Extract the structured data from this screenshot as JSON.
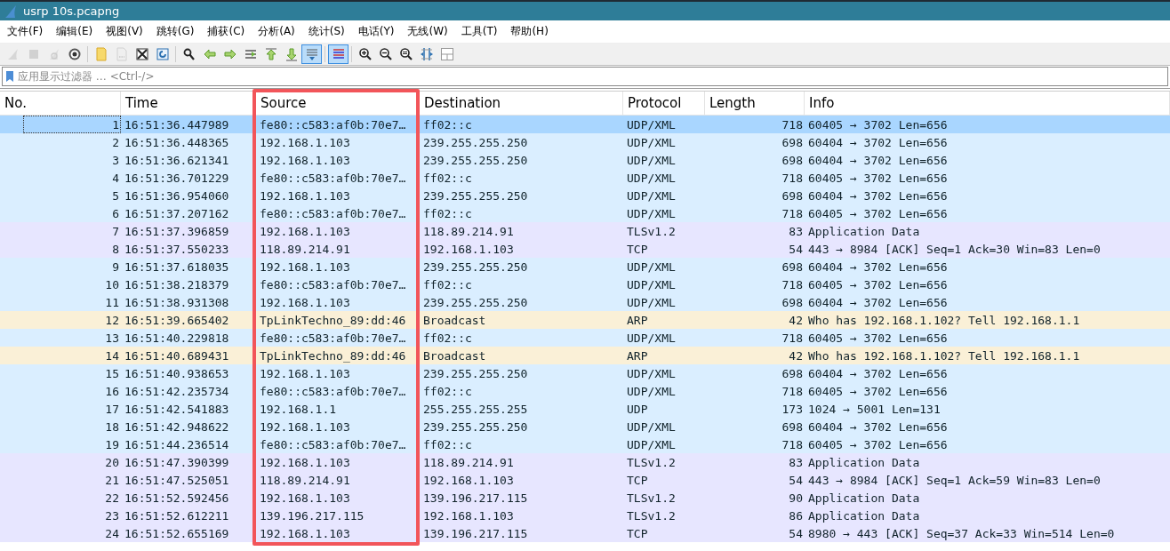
{
  "window": {
    "title": "usrp 10s.pcapng"
  },
  "menu": [
    "文件(F)",
    "编辑(E)",
    "视图(V)",
    "跳转(G)",
    "捕获(C)",
    "分析(A)",
    "统计(S)",
    "电话(Y)",
    "无线(W)",
    "工具(T)",
    "帮助(H)"
  ],
  "toolbar": [
    [
      {
        "kind": "start",
        "disabled": true,
        "pressed": false
      },
      {
        "kind": "stop",
        "disabled": true,
        "pressed": false
      },
      {
        "kind": "restart",
        "disabled": true,
        "pressed": false
      },
      {
        "kind": "options",
        "disabled": false,
        "pressed": false
      }
    ],
    [
      {
        "kind": "open",
        "disabled": false,
        "pressed": false
      },
      {
        "kind": "save",
        "disabled": true,
        "pressed": false
      },
      {
        "kind": "close",
        "disabled": false,
        "pressed": false
      },
      {
        "kind": "reload",
        "disabled": false,
        "pressed": false
      }
    ],
    [
      {
        "kind": "find",
        "disabled": false,
        "pressed": false
      },
      {
        "kind": "back",
        "disabled": false,
        "pressed": false
      },
      {
        "kind": "forward",
        "disabled": false,
        "pressed": false
      },
      {
        "kind": "goto",
        "disabled": false,
        "pressed": false
      },
      {
        "kind": "first",
        "disabled": false,
        "pressed": false
      },
      {
        "kind": "last",
        "disabled": false,
        "pressed": false
      },
      {
        "kind": "autoscroll",
        "disabled": false,
        "pressed": true
      }
    ],
    [
      {
        "kind": "colorize",
        "disabled": false,
        "pressed": true
      }
    ],
    [
      {
        "kind": "zoom-in",
        "disabled": false,
        "pressed": false
      },
      {
        "kind": "zoom-out",
        "disabled": false,
        "pressed": false
      },
      {
        "kind": "zoom-reset",
        "disabled": false,
        "pressed": false
      },
      {
        "kind": "resize",
        "disabled": false,
        "pressed": false
      },
      {
        "kind": "layout",
        "disabled": false,
        "pressed": false
      }
    ]
  ],
  "filter": {
    "placeholder": "应用显示过滤器 … <Ctrl-/>"
  },
  "table": {
    "columns": [
      {
        "label": "No.",
        "highlighted": false
      },
      {
        "label": "Time",
        "highlighted": false
      },
      {
        "label": "Source",
        "highlighted": true
      },
      {
        "label": "Destination",
        "highlighted": false
      },
      {
        "label": "Protocol",
        "highlighted": false
      },
      {
        "label": "Length",
        "highlighted": false
      },
      {
        "label": "Info",
        "highlighted": false
      }
    ],
    "rows": [
      {
        "cells": [
          "1",
          "16:51:36.447989",
          "fe80::c583:af0b:70e7…",
          "ff02::c",
          "UDP/XML",
          "718",
          "60405 → 3702 Len=656"
        ],
        "selected": true
      },
      {
        "cells": [
          "2",
          "16:51:36.448365",
          "192.168.1.103",
          "239.255.255.250",
          "UDP/XML",
          "698",
          "60404 → 3702 Len=656"
        ],
        "selected": false,
        "color": "#daeeff"
      },
      {
        "cells": [
          "3",
          "16:51:36.621341",
          "192.168.1.103",
          "239.255.255.250",
          "UDP/XML",
          "698",
          "60404 → 3702 Len=656"
        ],
        "selected": false,
        "color": "#daeeff"
      },
      {
        "cells": [
          "4",
          "16:51:36.701229",
          "fe80::c583:af0b:70e7…",
          "ff02::c",
          "UDP/XML",
          "718",
          "60405 → 3702 Len=656"
        ],
        "selected": false,
        "color": "#daeeff"
      },
      {
        "cells": [
          "5",
          "16:51:36.954060",
          "192.168.1.103",
          "239.255.255.250",
          "UDP/XML",
          "698",
          "60404 → 3702 Len=656"
        ],
        "selected": false,
        "color": "#daeeff"
      },
      {
        "cells": [
          "6",
          "16:51:37.207162",
          "fe80::c583:af0b:70e7…",
          "ff02::c",
          "UDP/XML",
          "718",
          "60405 → 3702 Len=656"
        ],
        "selected": false,
        "color": "#daeeff"
      },
      {
        "cells": [
          "7",
          "16:51:37.396859",
          "192.168.1.103",
          "118.89.214.91",
          "TLSv1.2",
          "83",
          "Application Data"
        ],
        "selected": false,
        "color": "#e7e6ff"
      },
      {
        "cells": [
          "8",
          "16:51:37.550233",
          "118.89.214.91",
          "192.168.1.103",
          "TCP",
          "54",
          "443 → 8984 [ACK] Seq=1 Ack=30 Win=83 Len=0"
        ],
        "selected": false,
        "color": "#e7e6ff"
      },
      {
        "cells": [
          "9",
          "16:51:37.618035",
          "192.168.1.103",
          "239.255.255.250",
          "UDP/XML",
          "698",
          "60404 → 3702 Len=656"
        ],
        "selected": false,
        "color": "#daeeff"
      },
      {
        "cells": [
          "10",
          "16:51:38.218379",
          "fe80::c583:af0b:70e7…",
          "ff02::c",
          "UDP/XML",
          "718",
          "60405 → 3702 Len=656"
        ],
        "selected": false,
        "color": "#daeeff"
      },
      {
        "cells": [
          "11",
          "16:51:38.931308",
          "192.168.1.103",
          "239.255.255.250",
          "UDP/XML",
          "698",
          "60404 → 3702 Len=656"
        ],
        "selected": false,
        "color": "#daeeff"
      },
      {
        "cells": [
          "12",
          "16:51:39.665402",
          "TpLinkTechno_89:dd:46",
          "Broadcast",
          "ARP",
          "42",
          "Who has 192.168.1.102? Tell 192.168.1.1"
        ],
        "selected": false,
        "color": "#faf0d7"
      },
      {
        "cells": [
          "13",
          "16:51:40.229818",
          "fe80::c583:af0b:70e7…",
          "ff02::c",
          "UDP/XML",
          "718",
          "60405 → 3702 Len=656"
        ],
        "selected": false,
        "color": "#daeeff"
      },
      {
        "cells": [
          "14",
          "16:51:40.689431",
          "TpLinkTechno_89:dd:46",
          "Broadcast",
          "ARP",
          "42",
          "Who has 192.168.1.102? Tell 192.168.1.1"
        ],
        "selected": false,
        "color": "#faf0d7"
      },
      {
        "cells": [
          "15",
          "16:51:40.938653",
          "192.168.1.103",
          "239.255.255.250",
          "UDP/XML",
          "698",
          "60404 → 3702 Len=656"
        ],
        "selected": false,
        "color": "#daeeff"
      },
      {
        "cells": [
          "16",
          "16:51:42.235734",
          "fe80::c583:af0b:70e7…",
          "ff02::c",
          "UDP/XML",
          "718",
          "60405 → 3702 Len=656"
        ],
        "selected": false,
        "color": "#daeeff"
      },
      {
        "cells": [
          "17",
          "16:51:42.541883",
          "192.168.1.1",
          "255.255.255.255",
          "UDP",
          "173",
          "1024 → 5001 Len=131"
        ],
        "selected": false,
        "color": "#daeeff"
      },
      {
        "cells": [
          "18",
          "16:51:42.948622",
          "192.168.1.103",
          "239.255.255.250",
          "UDP/XML",
          "698",
          "60404 → 3702 Len=656"
        ],
        "selected": false,
        "color": "#daeeff"
      },
      {
        "cells": [
          "19",
          "16:51:44.236514",
          "fe80::c583:af0b:70e7…",
          "ff02::c",
          "UDP/XML",
          "718",
          "60405 → 3702 Len=656"
        ],
        "selected": false,
        "color": "#daeeff"
      },
      {
        "cells": [
          "20",
          "16:51:47.390399",
          "192.168.1.103",
          "118.89.214.91",
          "TLSv1.2",
          "83",
          "Application Data"
        ],
        "selected": false,
        "color": "#e7e6ff"
      },
      {
        "cells": [
          "21",
          "16:51:47.525051",
          "118.89.214.91",
          "192.168.1.103",
          "TCP",
          "54",
          "443 → 8984 [ACK] Seq=1 Ack=59 Win=83 Len=0"
        ],
        "selected": false,
        "color": "#e7e6ff"
      },
      {
        "cells": [
          "22",
          "16:51:52.592456",
          "192.168.1.103",
          "139.196.217.115",
          "TLSv1.2",
          "90",
          "Application Data"
        ],
        "selected": false,
        "color": "#e7e6ff"
      },
      {
        "cells": [
          "23",
          "16:51:52.612211",
          "139.196.217.115",
          "192.168.1.103",
          "TLSv1.2",
          "86",
          "Application Data"
        ],
        "selected": false,
        "color": "#e7e6ff"
      },
      {
        "cells": [
          "24",
          "16:51:52.655169",
          "192.168.1.103",
          "139.196.217.115",
          "TCP",
          "54",
          "8980 → 443 [ACK] Seq=37 Ack=33 Win=514 Len=0"
        ],
        "selected": false,
        "color": "#e7e6ff"
      }
    ]
  }
}
